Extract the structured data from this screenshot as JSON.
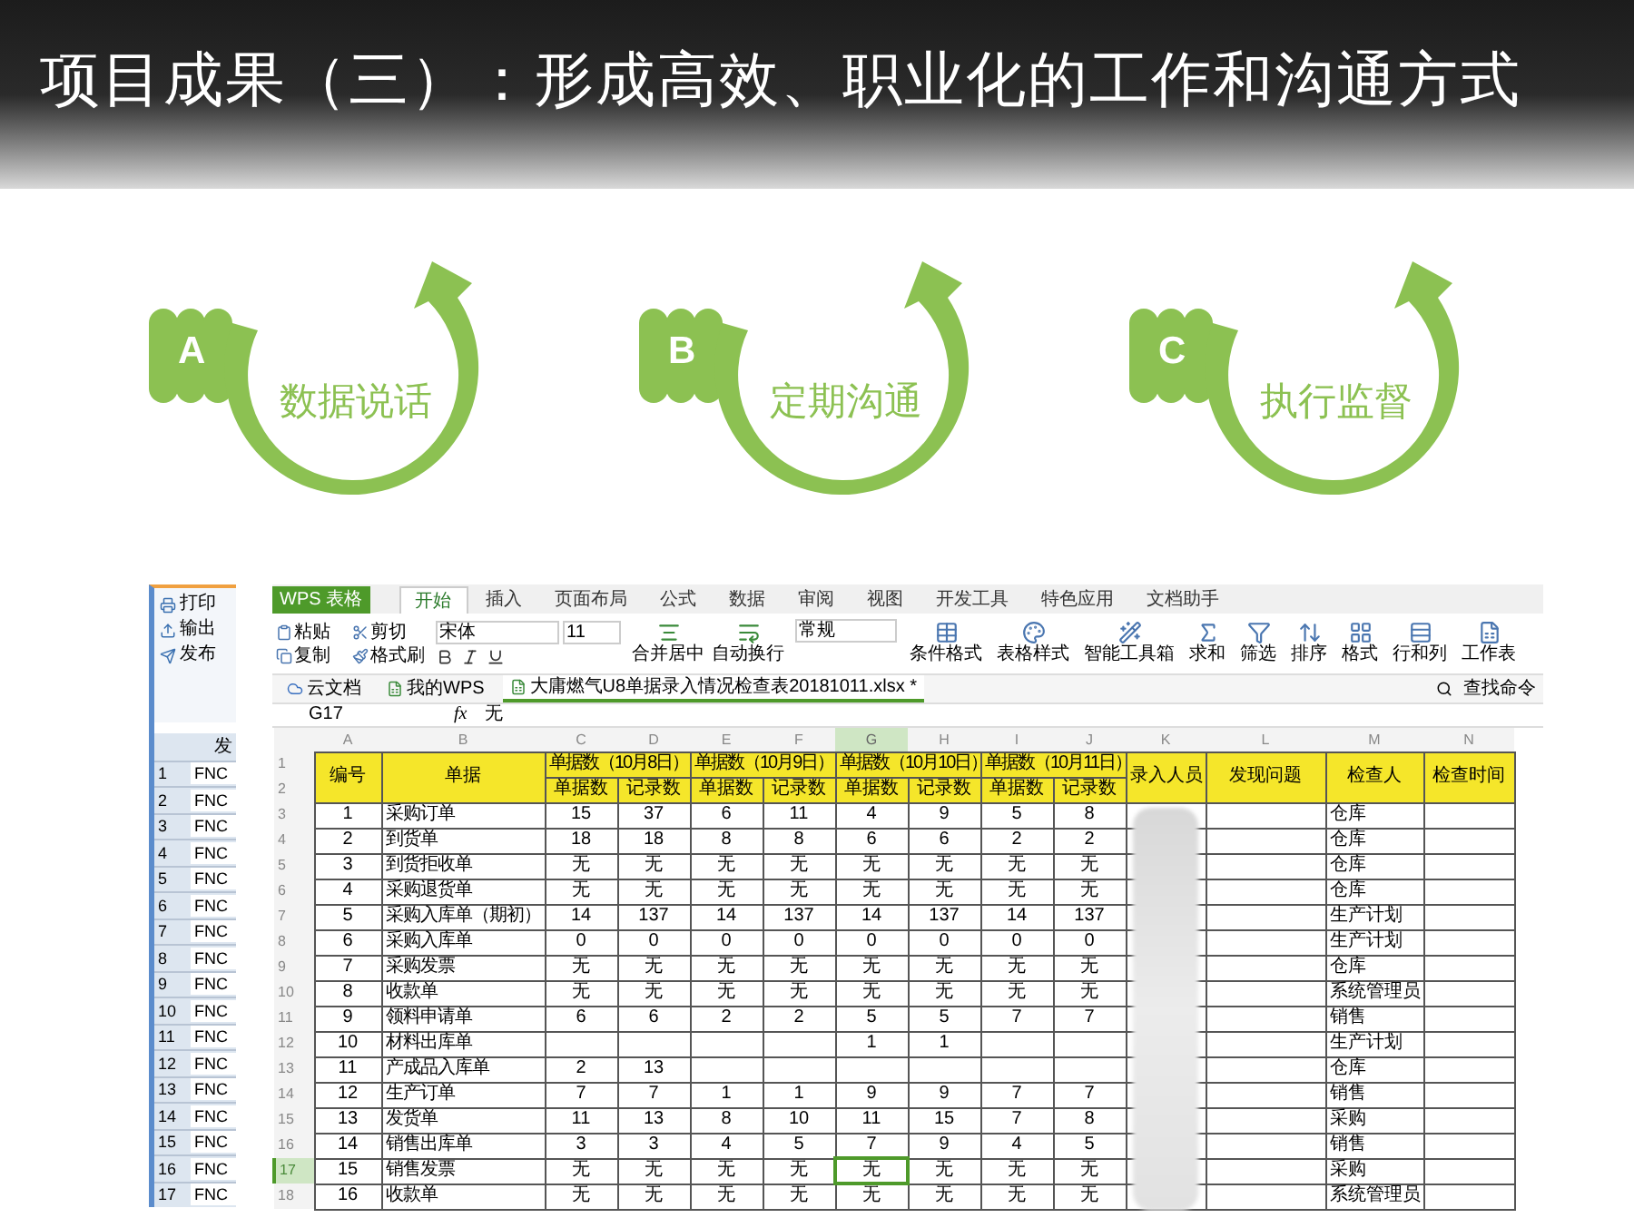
{
  "title": "项目成果（三）：形成高效、职业化的工作和沟通方式",
  "steps": [
    {
      "letter": "A",
      "label": "数据说话"
    },
    {
      "letter": "B",
      "label": "定期沟通"
    },
    {
      "letter": "C",
      "label": "执行监督"
    }
  ],
  "side_panel": {
    "items": [
      "打印",
      "输出",
      "发布"
    ],
    "table_header": "发",
    "rows": [
      {
        "number": "1",
        "code": "FNC"
      },
      {
        "number": "2",
        "code": "FNC"
      },
      {
        "number": "3",
        "code": "FNC"
      },
      {
        "number": "4",
        "code": "FNC"
      },
      {
        "number": "5",
        "code": "FNC"
      },
      {
        "number": "6",
        "code": "FNC"
      },
      {
        "number": "7",
        "code": "FNC"
      },
      {
        "number": "8",
        "code": "FNC"
      },
      {
        "number": "9",
        "code": "FNC"
      },
      {
        "number": "10",
        "code": "FNC"
      },
      {
        "number": "11",
        "code": "FNC"
      },
      {
        "number": "12",
        "code": "FNC"
      },
      {
        "number": "13",
        "code": "FNC"
      },
      {
        "number": "14",
        "code": "FNC"
      },
      {
        "number": "15",
        "code": "FNC"
      },
      {
        "number": "16",
        "code": "FNC"
      },
      {
        "number": "17",
        "code": "FNC"
      }
    ]
  },
  "spreadsheet": {
    "app_button": "WPS 表格",
    "menu_tabs": [
      {
        "label": "开始",
        "selected": true
      },
      {
        "label": "插入",
        "selected": false
      },
      {
        "label": "页面布局",
        "selected": false
      },
      {
        "label": "公式",
        "selected": false
      },
      {
        "label": "数据",
        "selected": false
      },
      {
        "label": "审阅",
        "selected": false
      },
      {
        "label": "视图",
        "selected": false
      },
      {
        "label": "开发工具",
        "selected": false
      },
      {
        "label": "特色应用",
        "selected": false
      },
      {
        "label": "文档助手",
        "selected": false
      }
    ],
    "ribbon": {
      "clipboard": [
        "粘贴",
        "剪切",
        "复制",
        "格式刷"
      ],
      "font": "宋体",
      "font_size": "11",
      "align_buttons": [
        "合并居中",
        "自动换行"
      ],
      "number_format": "常规",
      "tools": [
        "条件格式",
        "表格样式",
        "智能工具箱",
        "求和",
        "筛选",
        "排序",
        "格式",
        "行和列",
        "工作表"
      ]
    },
    "doc_tabs": [
      {
        "label": "云文档",
        "selected": false
      },
      {
        "label": "我的WPS",
        "selected": false
      },
      {
        "label": "大庸燃气U8单据录入情况检查表20181011.xlsx *",
        "selected": true
      }
    ],
    "command_search": "查找命令",
    "formula_bar": {
      "cell": "G17",
      "fx": "fx",
      "value": "无"
    },
    "columns": [
      {
        "letter": "A",
        "selected": false
      },
      {
        "letter": "B",
        "selected": false
      },
      {
        "letter": "C",
        "selected": false
      },
      {
        "letter": "D",
        "selected": false
      },
      {
        "letter": "E",
        "selected": false
      },
      {
        "letter": "F",
        "selected": false
      },
      {
        "letter": "G",
        "selected": true
      },
      {
        "letter": "H",
        "selected": false
      },
      {
        "letter": "I",
        "selected": false
      },
      {
        "letter": "J",
        "selected": false
      },
      {
        "letter": "K",
        "selected": false
      },
      {
        "letter": "L",
        "selected": false
      },
      {
        "letter": "M",
        "selected": false
      },
      {
        "letter": "N",
        "selected": false
      }
    ],
    "header_row_numbers": [
      "1",
      "2"
    ],
    "header": {
      "number": "编号",
      "document": "单据",
      "groups": [
        {
          "label": "单据数（10月8日）",
          "sub_headers": [
            "单据数",
            "记录数"
          ]
        },
        {
          "label": "单据数（10月9日）",
          "sub_headers": [
            "单据数",
            "记录数"
          ]
        },
        {
          "label": "单据数（10月10日）",
          "sub_headers": [
            "单据数",
            "记录数"
          ]
        },
        {
          "label": "单据数（10月11日）",
          "sub_headers": [
            "单据数",
            "记录数"
          ]
        }
      ],
      "entered_by": "录入人员",
      "issues": "发现问题",
      "checker": "检查人",
      "check_time": "检查时间"
    },
    "rows": [
      {
        "row_number": "3",
        "selected": false,
        "number": "1",
        "document": "采购订单",
        "counts": [
          {
            "documents": "15",
            "records": "37"
          },
          {
            "documents": "6",
            "records": "11"
          },
          {
            "documents": "4",
            "records": "9"
          },
          {
            "documents": "5",
            "records": "8"
          }
        ],
        "checker": "仓库"
      },
      {
        "row_number": "4",
        "selected": false,
        "number": "2",
        "document": "到货单",
        "counts": [
          {
            "documents": "18",
            "records": "18"
          },
          {
            "documents": "8",
            "records": "8"
          },
          {
            "documents": "6",
            "records": "6"
          },
          {
            "documents": "2",
            "records": "2"
          }
        ],
        "checker": "仓库"
      },
      {
        "row_number": "5",
        "selected": false,
        "number": "3",
        "document": "到货拒收单",
        "counts": [
          {
            "documents": "无",
            "records": "无"
          },
          {
            "documents": "无",
            "records": "无"
          },
          {
            "documents": "无",
            "records": "无"
          },
          {
            "documents": "无",
            "records": "无"
          }
        ],
        "checker": "仓库"
      },
      {
        "row_number": "6",
        "selected": false,
        "number": "4",
        "document": "采购退货单",
        "counts": [
          {
            "documents": "无",
            "records": "无"
          },
          {
            "documents": "无",
            "records": "无"
          },
          {
            "documents": "无",
            "records": "无"
          },
          {
            "documents": "无",
            "records": "无"
          }
        ],
        "checker": "仓库"
      },
      {
        "row_number": "7",
        "selected": false,
        "number": "5",
        "document": "采购入库单（期初）",
        "counts": [
          {
            "documents": "14",
            "records": "137"
          },
          {
            "documents": "14",
            "records": "137"
          },
          {
            "documents": "14",
            "records": "137"
          },
          {
            "documents": "14",
            "records": "137"
          }
        ],
        "checker": "生产计划"
      },
      {
        "row_number": "8",
        "selected": false,
        "number": "6",
        "document": "采购入库单",
        "counts": [
          {
            "documents": "0",
            "records": "0"
          },
          {
            "documents": "0",
            "records": "0"
          },
          {
            "documents": "0",
            "records": "0"
          },
          {
            "documents": "0",
            "records": "0"
          }
        ],
        "checker": "生产计划"
      },
      {
        "row_number": "9",
        "selected": false,
        "number": "7",
        "document": "采购发票",
        "counts": [
          {
            "documents": "无",
            "records": "无"
          },
          {
            "documents": "无",
            "records": "无"
          },
          {
            "documents": "无",
            "records": "无"
          },
          {
            "documents": "无",
            "records": "无"
          }
        ],
        "checker": "仓库"
      },
      {
        "row_number": "10",
        "selected": false,
        "number": "8",
        "document": "收款单",
        "counts": [
          {
            "documents": "无",
            "records": "无"
          },
          {
            "documents": "无",
            "records": "无"
          },
          {
            "documents": "无",
            "records": "无"
          },
          {
            "documents": "无",
            "records": "无"
          }
        ],
        "checker": "系统管理员"
      },
      {
        "row_number": "11",
        "selected": false,
        "number": "9",
        "document": "领料申请单",
        "counts": [
          {
            "documents": "6",
            "records": "6"
          },
          {
            "documents": "2",
            "records": "2"
          },
          {
            "documents": "5",
            "records": "5"
          },
          {
            "documents": "7",
            "records": "7"
          }
        ],
        "checker": "销售"
      },
      {
        "row_number": "12",
        "selected": false,
        "number": "10",
        "document": "材料出库单",
        "counts": [
          {
            "blank": true
          },
          {
            "blank": true
          },
          {
            "documents": "1",
            "records": "1"
          },
          {
            "blank": true
          }
        ],
        "checker": "生产计划"
      },
      {
        "row_number": "13",
        "selected": false,
        "number": "11",
        "document": "产成品入库单",
        "counts": [
          {
            "documents": "2",
            "records": "13"
          },
          {
            "blank": true
          },
          {
            "blank": true
          },
          {
            "blank": true
          }
        ],
        "checker": "仓库"
      },
      {
        "row_number": "14",
        "selected": false,
        "number": "12",
        "document": "生产订单",
        "counts": [
          {
            "documents": "7",
            "records": "7"
          },
          {
            "documents": "1",
            "records": "1"
          },
          {
            "documents": "9",
            "records": "9"
          },
          {
            "documents": "7",
            "records": "7"
          }
        ],
        "checker": "销售"
      },
      {
        "row_number": "15",
        "selected": false,
        "number": "13",
        "document": "发货单",
        "counts": [
          {
            "documents": "11",
            "records": "13"
          },
          {
            "documents": "8",
            "records": "10"
          },
          {
            "documents": "11",
            "records": "15"
          },
          {
            "documents": "7",
            "records": "8"
          }
        ],
        "checker": "采购"
      },
      {
        "row_number": "16",
        "selected": false,
        "number": "14",
        "document": "销售出库单",
        "counts": [
          {
            "documents": "3",
            "records": "3"
          },
          {
            "documents": "4",
            "records": "5"
          },
          {
            "documents": "7",
            "records": "9"
          },
          {
            "documents": "4",
            "records": "5"
          }
        ],
        "checker": "销售"
      },
      {
        "row_number": "17",
        "selected": true,
        "number": "15",
        "document": "销售发票",
        "counts": [
          {
            "documents": "无",
            "records": "无"
          },
          {
            "documents": "无",
            "records": "无"
          },
          {
            "documents": "无",
            "records": "无"
          },
          {
            "documents": "无",
            "records": "无"
          }
        ],
        "checker": "采购"
      },
      {
        "row_number": "18",
        "selected": false,
        "number": "16",
        "document": "收款单",
        "counts": [
          {
            "documents": "无",
            "records": "无"
          },
          {
            "documents": "无",
            "records": "无"
          },
          {
            "documents": "无",
            "records": "无"
          },
          {
            "documents": "无",
            "records": "无"
          }
        ],
        "checker": "系统管理员"
      }
    ]
  }
}
